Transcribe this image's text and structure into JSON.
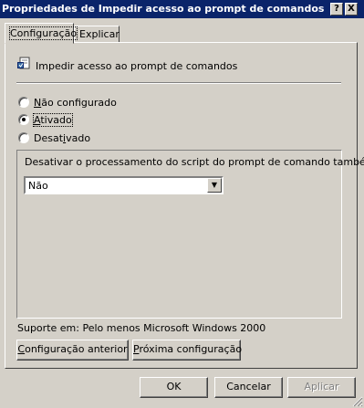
{
  "window": {
    "title": "Propriedades de Impedir acesso ao prompt de comandos",
    "help_label": "?",
    "close_label": "X"
  },
  "tabs": [
    {
      "label": "Configuração",
      "active": true
    },
    {
      "label": "Explicar",
      "active": false
    }
  ],
  "policy": {
    "icon": "policy-setting-icon",
    "name": "Impedir acesso ao prompt de comandos"
  },
  "state_options": [
    {
      "mnemonic": "N",
      "rest": "ão configurado",
      "selected": false
    },
    {
      "mnemonic": "A",
      "rest": "tivado",
      "selected": true
    },
    {
      "prefix": "Desat",
      "mnemonic": "i",
      "rest": "vado",
      "selected": false
    }
  ],
  "options": {
    "question": "Desativar o processamento do script do prompt de comando também?",
    "select_value": "Não"
  },
  "support": {
    "text": "Suporte em: Pelo menos Microsoft Windows 2000"
  },
  "nav_buttons": {
    "previous": {
      "mnemonic": "C",
      "rest": "onfiguração anterior"
    },
    "next": {
      "mnemonic": "P",
      "rest": "róxima configuração"
    }
  },
  "footer_buttons": {
    "ok": "OK",
    "cancel": "Cancelar",
    "apply": "Aplicar",
    "apply_enabled": false
  }
}
